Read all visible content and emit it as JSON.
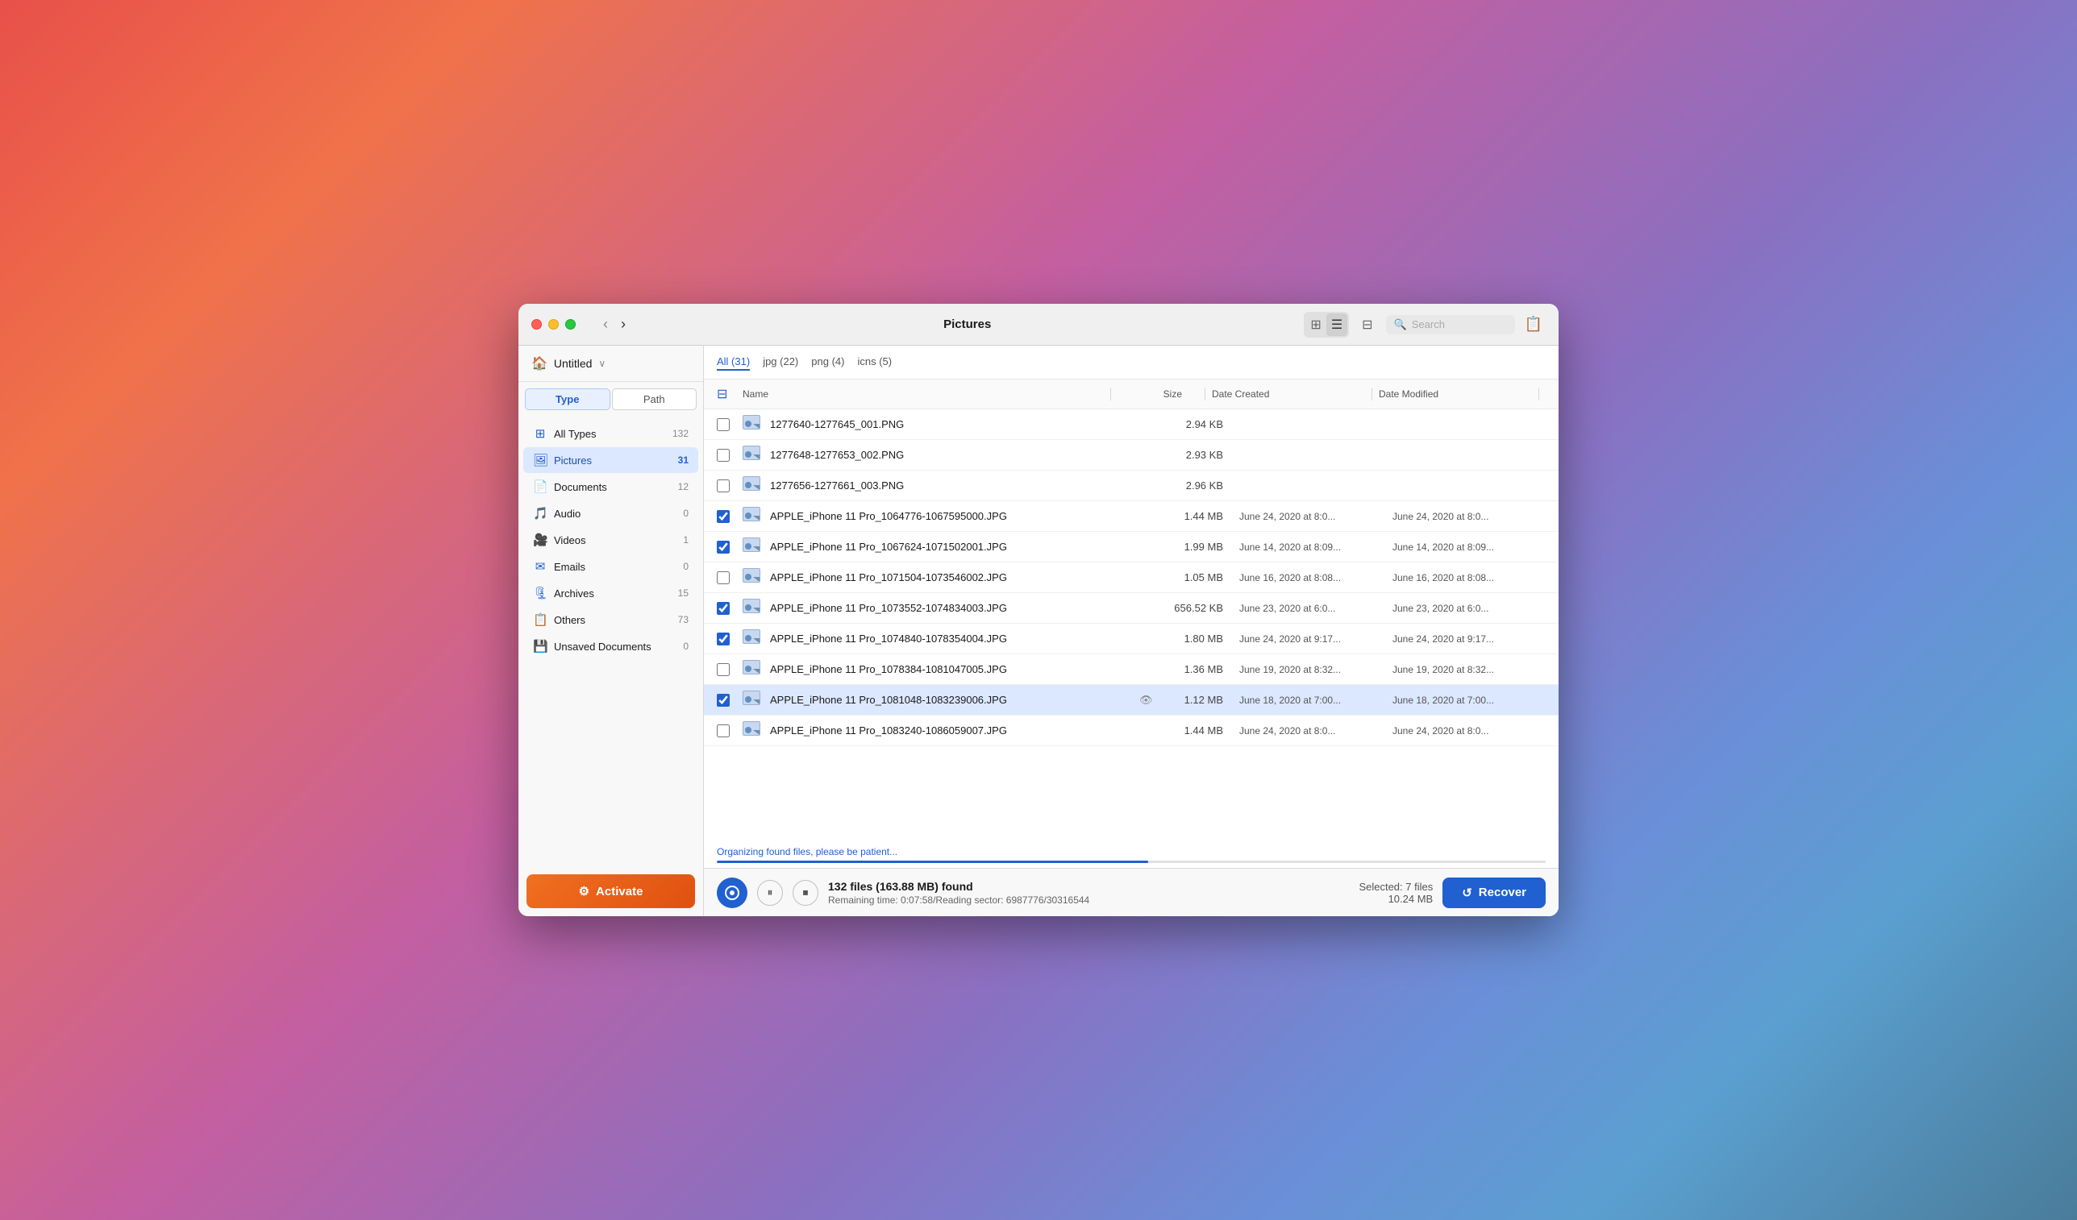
{
  "window": {
    "title": "Pictures"
  },
  "sidebar": {
    "project_name": "Untitled",
    "tabs": [
      {
        "label": "Type",
        "active": true
      },
      {
        "label": "Path",
        "active": false
      }
    ],
    "items": [
      {
        "label": "All Types",
        "count": "132",
        "icon": "⊞",
        "active": false
      },
      {
        "label": "Pictures",
        "count": "31",
        "icon": "🖼",
        "active": true
      },
      {
        "label": "Documents",
        "count": "12",
        "icon": "📄",
        "active": false
      },
      {
        "label": "Audio",
        "count": "0",
        "icon": "🎵",
        "active": false
      },
      {
        "label": "Videos",
        "count": "1",
        "icon": "🎥",
        "active": false
      },
      {
        "label": "Emails",
        "count": "0",
        "icon": "✉",
        "active": false
      },
      {
        "label": "Archives",
        "count": "15",
        "icon": "🗜",
        "active": false
      },
      {
        "label": "Others",
        "count": "73",
        "icon": "📋",
        "active": false
      },
      {
        "label": "Unsaved Documents",
        "count": "0",
        "icon": "💾",
        "active": false
      }
    ],
    "activate_label": "Activate"
  },
  "toolbar": {
    "nav_back": "‹",
    "nav_forward": "›",
    "search_placeholder": "Search",
    "filter_icon": "⊟"
  },
  "file_tabs": [
    {
      "label": "All (31)",
      "active": true
    },
    {
      "label": "jpg (22)",
      "active": false
    },
    {
      "label": "png (4)",
      "active": false
    },
    {
      "label": "icns (5)",
      "active": false
    }
  ],
  "columns": {
    "name": "Name",
    "size": "Size",
    "date_created": "Date Created",
    "date_modified": "Date Modified"
  },
  "files": [
    {
      "name": "1277640-1277645_001.PNG",
      "size": "2.94 KB",
      "created": "",
      "modified": "",
      "checked": false,
      "selected": false
    },
    {
      "name": "1277648-1277653_002.PNG",
      "size": "2.93 KB",
      "created": "",
      "modified": "",
      "checked": false,
      "selected": false
    },
    {
      "name": "1277656-1277661_003.PNG",
      "size": "2.96 KB",
      "created": "",
      "modified": "",
      "checked": false,
      "selected": false
    },
    {
      "name": "APPLE_iPhone 11 Pro_1064776-1067595000.JPG",
      "size": "1.44 MB",
      "created": "June 24, 2020 at 8:0...",
      "modified": "June 24, 2020 at 8:0...",
      "checked": true,
      "selected": false
    },
    {
      "name": "APPLE_iPhone 11 Pro_1067624-1071502001.JPG",
      "size": "1.99 MB",
      "created": "June 14, 2020 at 8:09...",
      "modified": "June 14, 2020 at 8:09...",
      "checked": true,
      "selected": false
    },
    {
      "name": "APPLE_iPhone 11 Pro_1071504-1073546002.JPG",
      "size": "1.05 MB",
      "created": "June 16, 2020 at 8:08...",
      "modified": "June 16, 2020 at 8:08...",
      "checked": false,
      "selected": false
    },
    {
      "name": "APPLE_iPhone 11 Pro_1073552-1074834003.JPG",
      "size": "656.52 KB",
      "created": "June 23, 2020 at 6:0...",
      "modified": "June 23, 2020 at 6:0...",
      "checked": true,
      "selected": false
    },
    {
      "name": "APPLE_iPhone 11 Pro_1074840-1078354004.JPG",
      "size": "1.80 MB",
      "created": "June 24, 2020 at 9:17...",
      "modified": "June 24, 2020 at 9:17...",
      "checked": true,
      "selected": false
    },
    {
      "name": "APPLE_iPhone 11 Pro_1078384-1081047005.JPG",
      "size": "1.36 MB",
      "created": "June 19, 2020 at 8:32...",
      "modified": "June 19, 2020 at 8:32...",
      "checked": false,
      "selected": false
    },
    {
      "name": "APPLE_iPhone 11 Pro_1081048-1083239006.JPG",
      "size": "1.12 MB",
      "created": "June 18, 2020 at 7:00...",
      "modified": "June 18, 2020 at 7:00...",
      "checked": true,
      "selected": true,
      "has_eye": true
    },
    {
      "name": "APPLE_iPhone 11 Pro_1083240-1086059007.JPG",
      "size": "1.44 MB",
      "created": "June 24, 2020 at 8:0...",
      "modified": "June 24, 2020 at 8:0...",
      "checked": false,
      "selected": false
    }
  ],
  "progress": {
    "label": "Organizing found files, please be patient...",
    "percent": 52
  },
  "bottom_bar": {
    "files_found": "132 files (163.88 MB) found",
    "remaining": "Remaining time: 0:07:58/Reading sector: 6987776/30316544",
    "selected_files": "Selected: 7 files",
    "selected_size": "10.24 MB",
    "recover_label": "Recover"
  }
}
